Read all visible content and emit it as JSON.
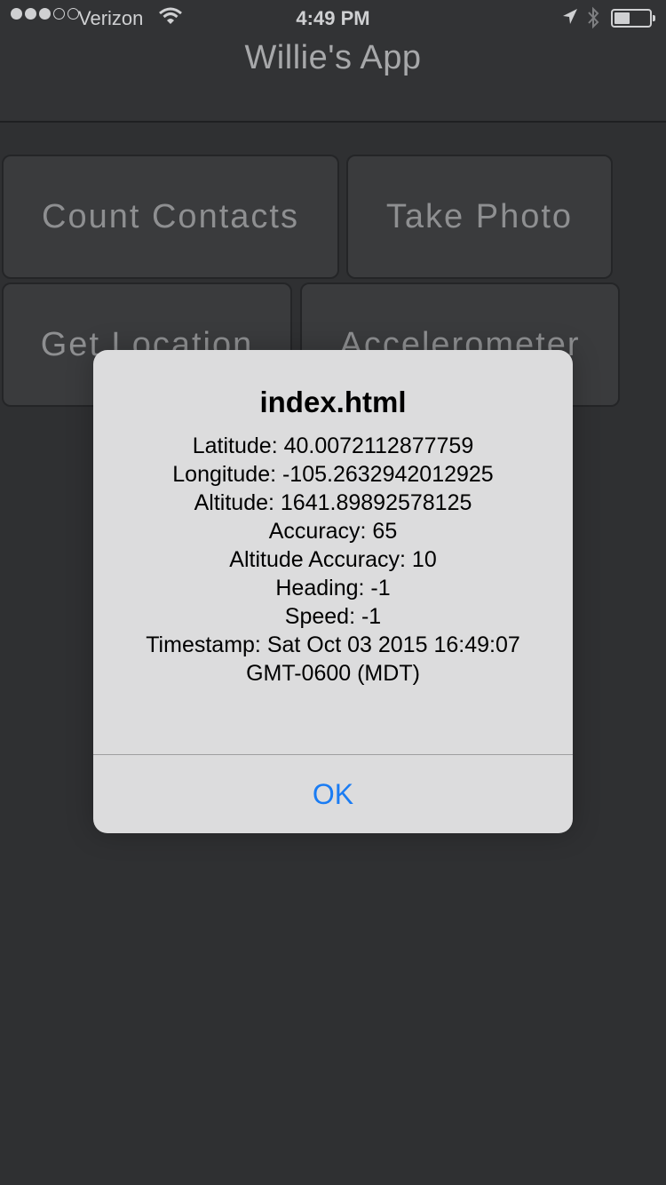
{
  "status_bar": {
    "carrier": "Verizon",
    "time": "4:49 PM",
    "signal_bars_filled": 3,
    "signal_bars_total": 5,
    "battery_level": 0.45
  },
  "header": {
    "title": "Willie's App"
  },
  "buttons": [
    {
      "label": "Count Contacts"
    },
    {
      "label": "Take Photo"
    },
    {
      "label": "Get Location"
    },
    {
      "label": "Accelerometer"
    }
  ],
  "alert": {
    "title": "index.html",
    "lines": [
      "Latitude: 40.0072112877759",
      "Longitude: -105.2632942012925",
      "Altitude: 1641.89892578125",
      "Accuracy: 65",
      "Altitude Accuracy: 10",
      "Heading: -1",
      "Speed: -1",
      "Timestamp: Sat Oct 03 2015 16:49:07",
      "GMT-0600 (MDT)"
    ],
    "ok_label": "OK"
  },
  "colors": {
    "accent": "#1a7cf3",
    "background": "#2f3032",
    "dialog": "#dcdcdd"
  }
}
